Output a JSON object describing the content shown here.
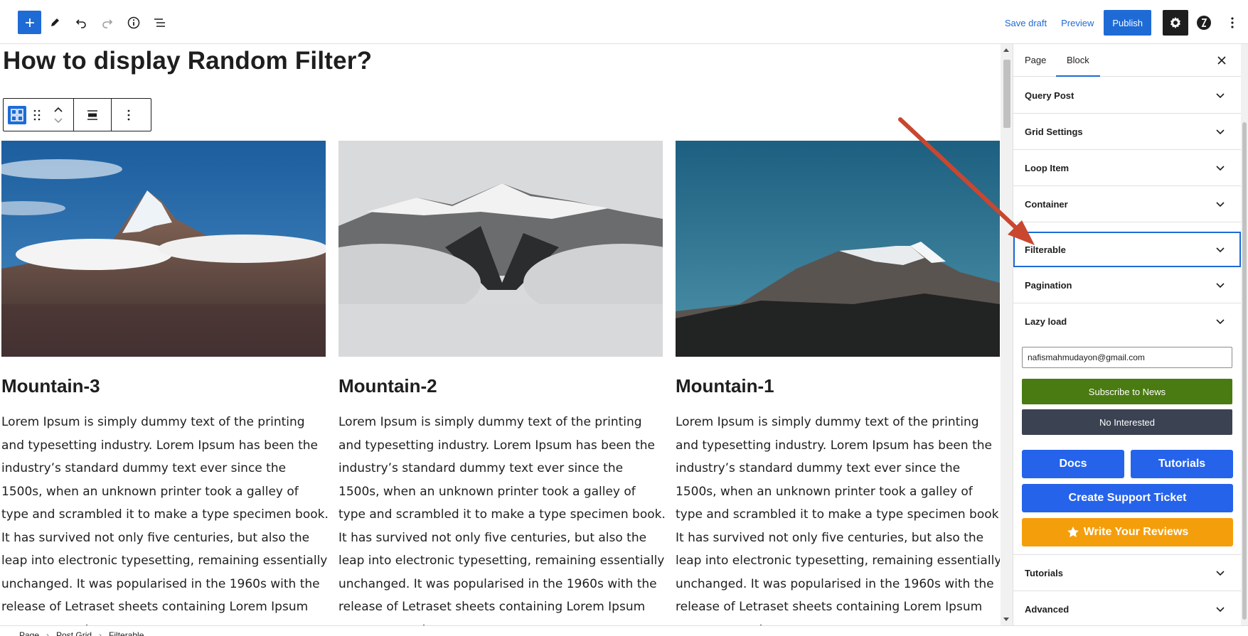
{
  "toolbar": {
    "save_draft": "Save draft",
    "preview": "Preview",
    "publish": "Publish",
    "icons": [
      "plus-icon",
      "pen-icon",
      "undo-icon",
      "redo-icon",
      "info-icon",
      "list-view-icon",
      "gear-icon",
      "plugin-logo-icon",
      "more-vertical-icon"
    ],
    "accent": "#1e6bd6"
  },
  "post": {
    "title": "How to display Random Filter?"
  },
  "posts": [
    {
      "name": "Mountain-3",
      "excerpt": "Lorem Ipsum is simply dummy text of the printing and typesetting industry. Lorem Ipsum has been the industry’s standard dummy text ever since the 1500s, when an unknown printer took a galley of type and scrambled it to make a type specimen book. It has survived not only five centuries, but also the leap into electronic typesetting, remaining essentially unchanged. It was popularised in the 1960s with the release of Letraset sheets containing Lorem Ipsum passages, and"
    },
    {
      "name": "Mountain-2",
      "excerpt": "Lorem Ipsum is simply dummy text of the printing and typesetting industry. Lorem Ipsum has been the industry’s standard dummy text ever since the 1500s, when an unknown printer took a galley of type and scrambled it to make a type specimen book. It has survived not only five centuries, but also the leap into electronic typesetting, remaining essentially unchanged. It was popularised in the 1960s with the release of Letraset sheets containing Lorem Ipsum passages, and"
    },
    {
      "name": "Mountain-1",
      "excerpt": "Lorem Ipsum is simply dummy text of the printing and typesetting industry. Lorem Ipsum has been the industry’s standard dummy text ever since the 1500s, when an unknown printer took a galley of type and scrambled it to make a type specimen book. It has survived not only five centuries, but also the leap into electronic typesetting, remaining essentially unchanged. It was popularised in the 1960s with the release of Letraset sheets containing Lorem Ipsum passages, and"
    }
  ],
  "sidebar": {
    "tabs": [
      {
        "label": "Page"
      },
      {
        "label": "Block"
      }
    ],
    "panels": [
      {
        "title": "Query Post"
      },
      {
        "title": "Grid Settings"
      },
      {
        "title": "Loop Item"
      },
      {
        "title": "Container"
      },
      {
        "title": "Filterable"
      },
      {
        "title": "Pagination"
      },
      {
        "title": "Lazy load"
      }
    ],
    "email_value": "nafismahmudayon@gmail.com",
    "subscribe": "Subscribe to News",
    "no_interest": "No Interested",
    "docs": "Docs",
    "tutorials_btn": "Tutorials",
    "support": "Create Support Ticket",
    "reviews": "Write Your Reviews",
    "bottom_panels": [
      {
        "title": "Tutorials"
      },
      {
        "title": "Advanced"
      }
    ],
    "colors": {
      "subscribe": "#4a7a12",
      "no_interest": "#3b4252",
      "action_blue": "#2563eb",
      "reviews": "#f59e0b"
    }
  },
  "breadcrumb": [
    "Page",
    "Post Grid",
    "Filterable"
  ]
}
